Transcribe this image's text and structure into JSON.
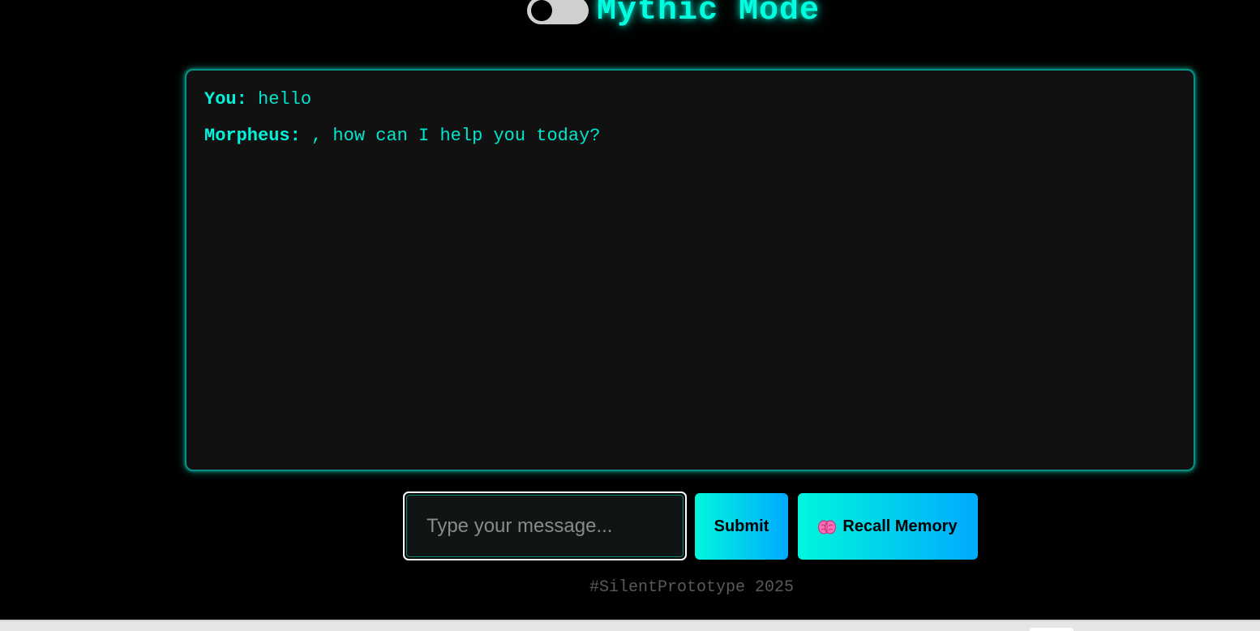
{
  "header": {
    "mode_toggle_on": false,
    "title": "Mythic Mode"
  },
  "chat": {
    "messages": [
      {
        "speaker": "You:",
        "text": " hello"
      },
      {
        "speaker": "Morpheus:",
        "text": " , how can I help you today?"
      }
    ]
  },
  "composer": {
    "value": "",
    "placeholder": "Type your message...",
    "submit_label": "Submit",
    "recall_label": "Recall Memory",
    "recall_icon": "brain-icon"
  },
  "footer": {
    "text": "#SilentPrototype 2025"
  },
  "colors": {
    "accent": "#00ffe0",
    "background": "#000000",
    "panel": "#111111",
    "button_gradient_start": "#00f7dc",
    "button_gradient_end": "#00aaff"
  }
}
